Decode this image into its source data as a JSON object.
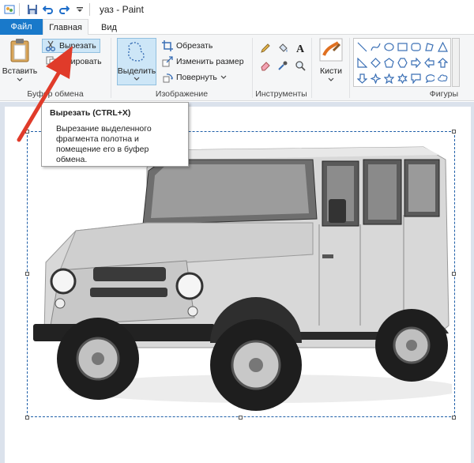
{
  "window": {
    "title": "уаз - Paint"
  },
  "tabs": {
    "file": "Файл",
    "home": "Главная",
    "view": "Вид"
  },
  "clipboard": {
    "label": "Буфер обмена",
    "paste": "Вставить",
    "cut": "Вырезать",
    "copy": "пировать"
  },
  "image": {
    "label": "Изображение",
    "select": "Выделить",
    "crop": "Обрезать",
    "resize": "Изменить размер",
    "rotate": "Повернуть"
  },
  "tools": {
    "label": "Инструменты"
  },
  "brushes": {
    "label": "Кисти"
  },
  "shapes": {
    "label": "Фигуры"
  },
  "tooltip": {
    "title": "Вырезать (CTRL+X)",
    "line1": "Вырезание выделенного",
    "line2": "фрагмента полотна и",
    "line3": "помещение его в буфер",
    "line4": "обмена."
  },
  "colors": {
    "file_tab": "#1979ca",
    "ribbon_bg": "#f5f6f7",
    "workspace_bg": "#dbe2ec",
    "highlight": "#cde6f7",
    "arrow": "#e03b2a"
  }
}
